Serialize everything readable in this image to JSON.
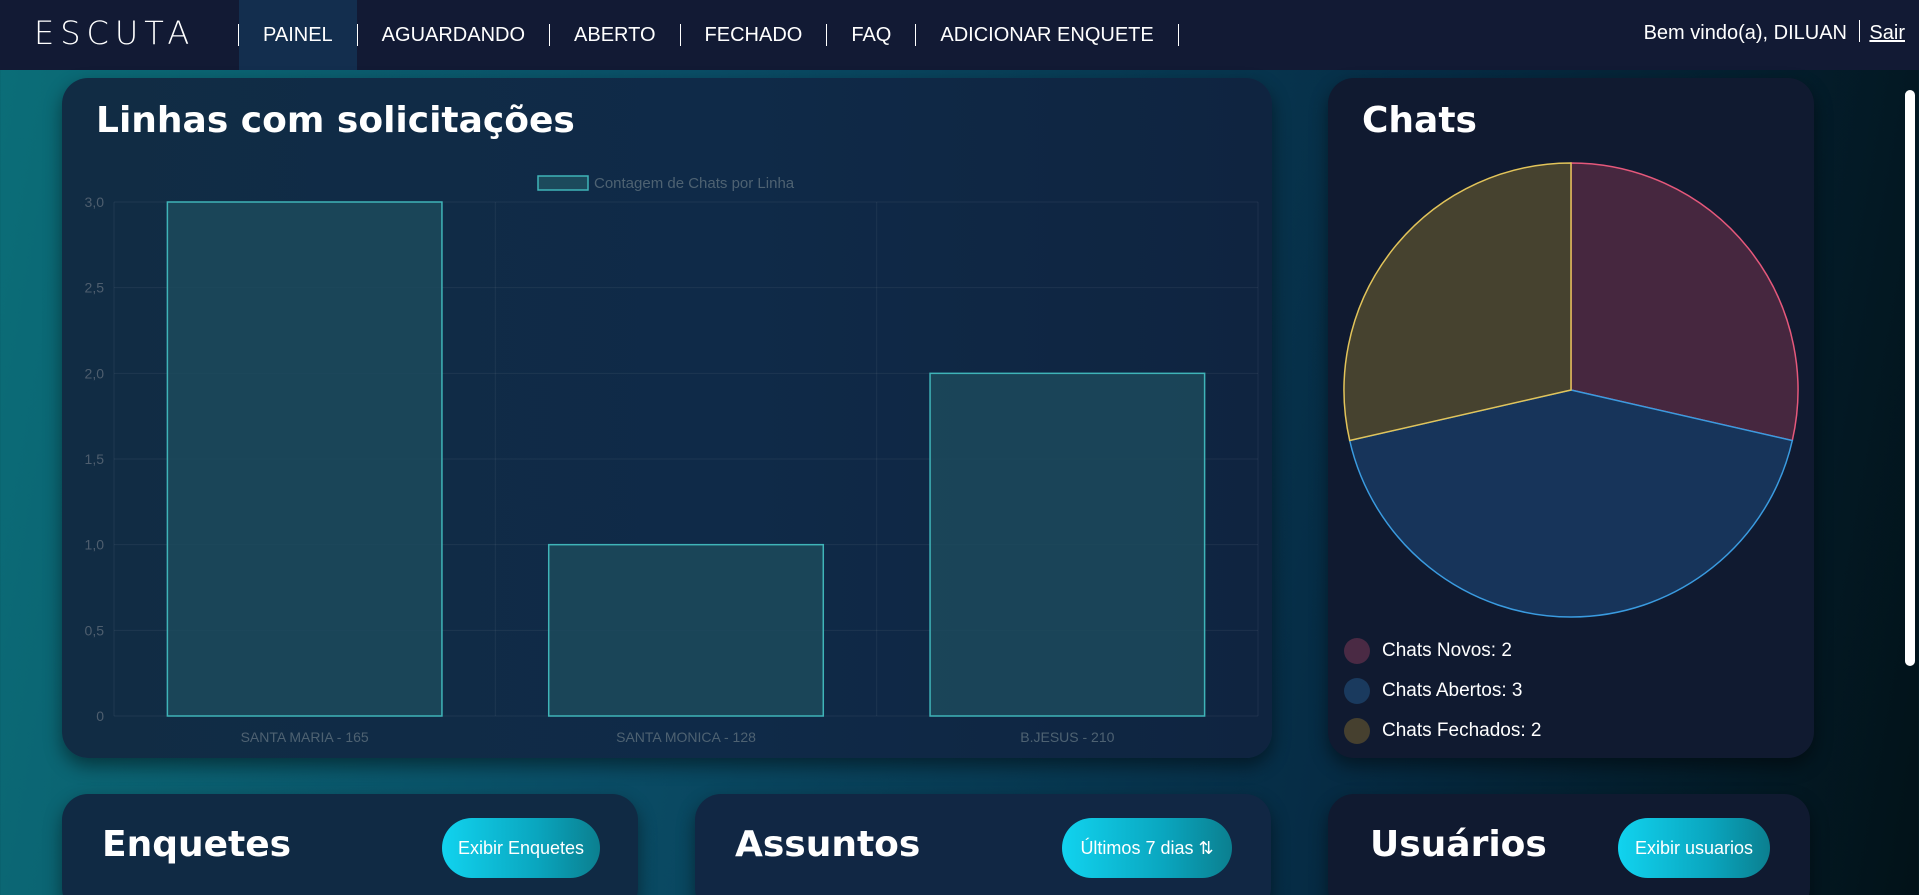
{
  "nav": {
    "logo": "ESCUTA",
    "items": [
      {
        "label": "PAINEL",
        "active": true
      },
      {
        "label": "AGUARDANDO"
      },
      {
        "label": "ABERTO"
      },
      {
        "label": "FECHADO"
      },
      {
        "label": "FAQ"
      },
      {
        "label": "ADICIONAR ENQUETE"
      }
    ],
    "greeting": "Bem vindo(a), DILUAN",
    "logout": "Sair"
  },
  "bar_card": {
    "title": "Linhas com solicitações"
  },
  "pie_card": {
    "title": "Chats",
    "legend": [
      {
        "label": "Chats Novos: 2",
        "color": "#4a2a44"
      },
      {
        "label": "Chats Abertos: 3",
        "color": "#1a3a5e"
      },
      {
        "label": "Chats Fechados: 2",
        "color": "#46402f"
      }
    ]
  },
  "bottom": {
    "enquetes": {
      "title": "Enquetes",
      "button": "Exibir Enquetes"
    },
    "assuntos": {
      "title": "Assuntos",
      "button": "Últimos 7 dias ⇅"
    },
    "usuarios": {
      "title": "Usuários",
      "button": "Exibir usuarios"
    }
  },
  "chart_data": [
    {
      "type": "bar",
      "categories": [
        "SANTA MARIA - 165",
        "SANTA MONICA - 128",
        "B.JESUS - 210"
      ],
      "series": [
        {
          "name": "Contagem de Chats por Linha",
          "values": [
            3,
            1,
            2
          ]
        }
      ],
      "ylim": [
        0,
        3
      ],
      "yticks": [
        "0",
        "0,5",
        "1,0",
        "1,5",
        "2,0",
        "2,5",
        "3,0"
      ],
      "grid": true,
      "legend": "top",
      "colors": {
        "bar_fill": "#1c4a5c",
        "bar_stroke": "#3fb4b8"
      }
    },
    {
      "type": "pie",
      "labels": [
        "Chats Novos",
        "Chats Abertos",
        "Chats Fechados"
      ],
      "values": [
        2,
        3,
        2
      ],
      "colors": {
        "fill": [
          "#46273f",
          "#17345a",
          "#46422f"
        ],
        "stroke": [
          "#e5587b",
          "#3a9be0",
          "#e2c45a"
        ]
      },
      "legend": "bottom"
    }
  ]
}
